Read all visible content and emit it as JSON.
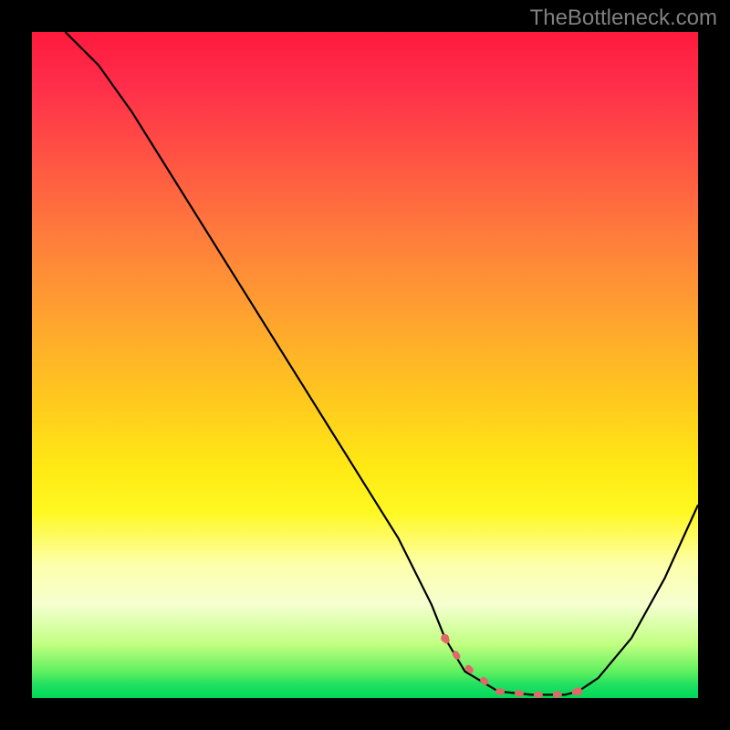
{
  "watermark": "TheBottleneck.com",
  "chart_data": {
    "type": "line",
    "title": "",
    "xlabel": "",
    "ylabel": "",
    "xlim": [
      0,
      100
    ],
    "ylim": [
      0,
      100
    ],
    "series": [
      {
        "name": "curve",
        "color": "#000000",
        "x": [
          5,
          10,
          15,
          20,
          25,
          30,
          35,
          40,
          45,
          50,
          55,
          60,
          62,
          65,
          70,
          75,
          80,
          82,
          85,
          90,
          95,
          100
        ],
        "values": [
          100,
          95,
          88,
          80,
          72,
          64,
          56,
          48,
          40,
          32,
          24,
          14,
          9,
          4,
          1,
          0.5,
          0.5,
          1,
          3,
          9,
          18,
          29
        ]
      }
    ],
    "markers": {
      "name": "highlight-segment",
      "color": "#e06868",
      "x": [
        62,
        64,
        66,
        68,
        70,
        72,
        74,
        76,
        78,
        80,
        82
      ],
      "values": [
        9,
        6,
        4,
        2.5,
        1,
        0.8,
        0.6,
        0.5,
        0.5,
        0.6,
        1
      ]
    },
    "gradient_stops": [
      {
        "pos": 0,
        "color": "#ff1a3d"
      },
      {
        "pos": 30,
        "color": "#ff7a3c"
      },
      {
        "pos": 55,
        "color": "#ffc81e"
      },
      {
        "pos": 80,
        "color": "#fdffac"
      },
      {
        "pos": 96,
        "color": "#60f060"
      },
      {
        "pos": 100,
        "color": "#00d858"
      }
    ]
  }
}
